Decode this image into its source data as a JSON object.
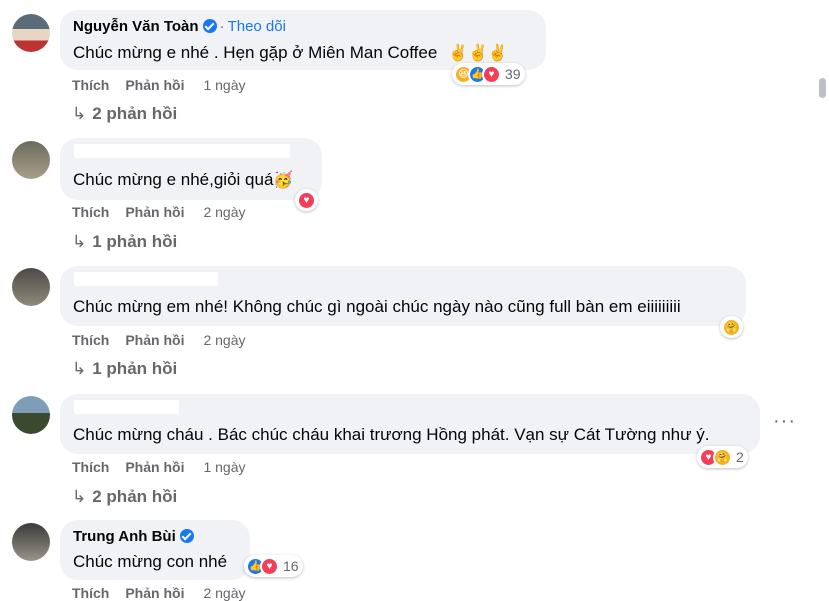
{
  "comments": [
    {
      "author": "Nguyễn Văn Toàn",
      "follow_label": "Theo dõi",
      "text": "Chúc mừng e nhé . Hẹn gặp ở Miên Man Coffee",
      "emoji": "✌️✌️✌️",
      "like_label": "Thích",
      "reply_label": "Phản hồi",
      "time": "1 ngày",
      "reaction_count": "39",
      "replies": "2 phản hồi"
    },
    {
      "author": "",
      "text": "Chúc mừng e nhé,giỏi quá",
      "emoji": "🥳",
      "like_label": "Thích",
      "reply_label": "Phản hồi",
      "time": "2 ngày",
      "replies": "1 phản hồi"
    },
    {
      "author": "",
      "text": "Chúc mừng em nhé! Không chúc gì ngoài chúc ngày nào cũng full bàn em eiiiiiiiii",
      "like_label": "Thích",
      "reply_label": "Phản hồi",
      "time": "2 ngày",
      "replies": "1 phản hồi"
    },
    {
      "author": "",
      "text": "Chúc mừng cháu . Bác chúc cháu khai trương Hồng phát. Vạn sự Cát Tường như ý.",
      "like_label": "Thích",
      "reply_label": "Phản hồi",
      "time": "1 ngày",
      "reaction_count": "2",
      "replies": "2 phản hồi",
      "more_label": "···"
    },
    {
      "author": "Trung Anh Bùi",
      "text": "Chúc mừng con nhé",
      "like_label": "Thích",
      "reply_label": "Phản hồi",
      "time": "2 ngày",
      "reaction_count": "16"
    }
  ],
  "colors": {
    "bubble": "#f0f2f5",
    "link": "#1877f2",
    "meta": "#65676b",
    "like": "#1877f2",
    "love": "#f33e58",
    "haha": "#f7b125"
  },
  "icons": {
    "reply_arrow": "↳",
    "like": "👍",
    "love": "♥",
    "haha": "😆",
    "care": "🤗"
  }
}
